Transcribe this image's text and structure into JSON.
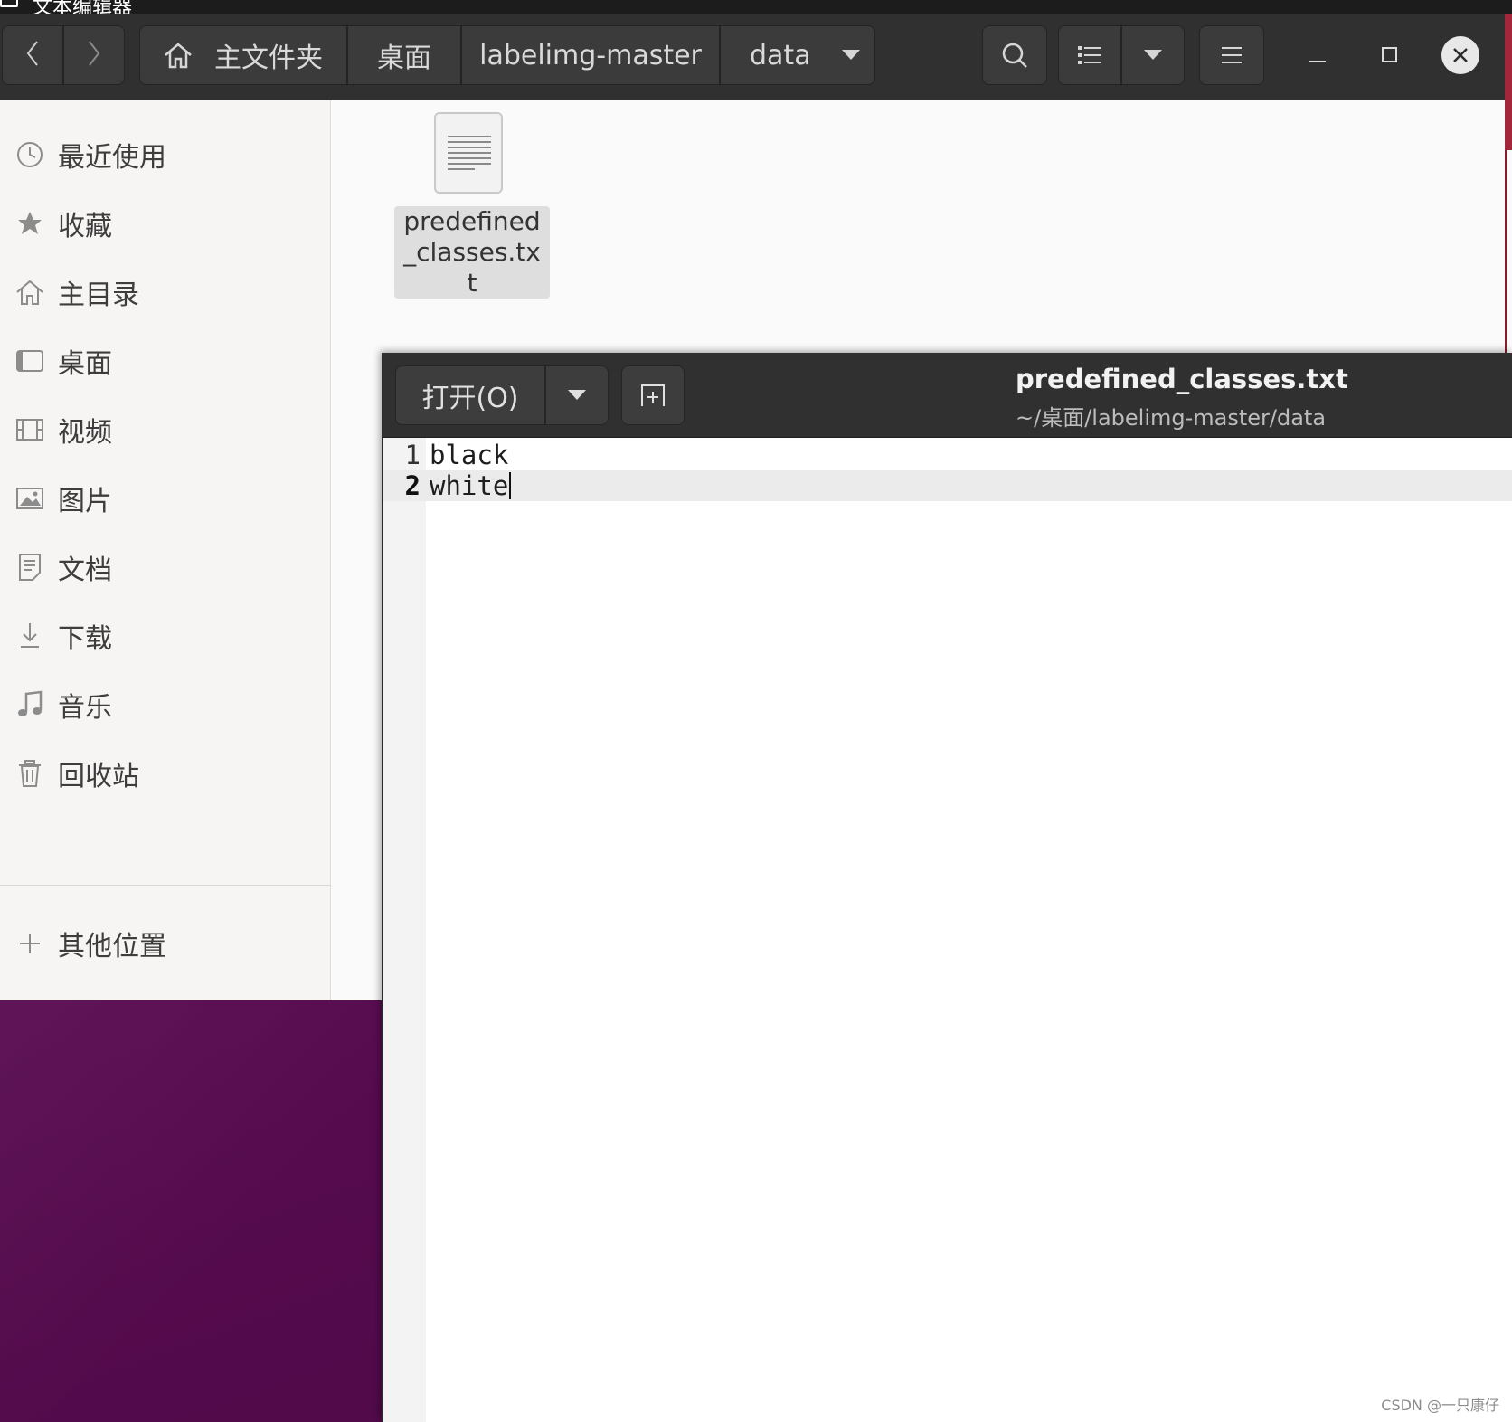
{
  "topbar": {
    "app_title": "文本编辑器"
  },
  "file_manager": {
    "nav": {
      "back_icon": "chevron-left-icon",
      "forward_icon": "chevron-right-icon"
    },
    "breadcrumbs": [
      {
        "label": "主文件夹",
        "icon": "home-icon"
      },
      {
        "label": "桌面"
      },
      {
        "label": "labelimg-master"
      },
      {
        "label": "data"
      }
    ],
    "toolbar": {
      "search_icon": "search-icon",
      "view_icon": "list-view-icon",
      "view_dropdown_icon": "chevron-down-icon",
      "menu_icon": "hamburger-menu-icon"
    },
    "window_controls": {
      "minimize_icon": "minimize-icon",
      "maximize_icon": "maximize-icon",
      "close_icon": "close-icon"
    },
    "sidebar": {
      "items": [
        {
          "label": "最近使用",
          "icon": "clock-icon"
        },
        {
          "label": "收藏",
          "icon": "star-icon"
        },
        {
          "label": "主目录",
          "icon": "home-icon"
        },
        {
          "label": "桌面",
          "icon": "desktop-icon"
        },
        {
          "label": "视频",
          "icon": "video-icon"
        },
        {
          "label": "图片",
          "icon": "picture-icon"
        },
        {
          "label": "文档",
          "icon": "document-icon"
        },
        {
          "label": "下载",
          "icon": "download-icon"
        },
        {
          "label": "音乐",
          "icon": "music-icon"
        },
        {
          "label": "回收站",
          "icon": "trash-icon"
        }
      ],
      "other_locations": {
        "label": "其他位置",
        "icon": "plus-icon"
      }
    },
    "files": [
      {
        "name": "predefined_classes.txt",
        "icon": "text-file-icon"
      }
    ]
  },
  "editor": {
    "open_button": "打开(O)",
    "open_dropdown_icon": "chevron-down-icon",
    "new_tab_icon": "new-document-icon",
    "title": "predefined_classes.txt",
    "path": "~/桌面/labelimg-master/data",
    "lines": [
      {
        "number": "1",
        "text": "black"
      },
      {
        "number": "2",
        "text": "white"
      }
    ],
    "current_line": 2
  },
  "watermark": "CSDN @一只康仔",
  "colors": {
    "header_dark": "#303030",
    "sidebar_bg": "#f6f5f4",
    "desktop_purple": "#5e0f55",
    "editor_bg": "#ffffff"
  }
}
